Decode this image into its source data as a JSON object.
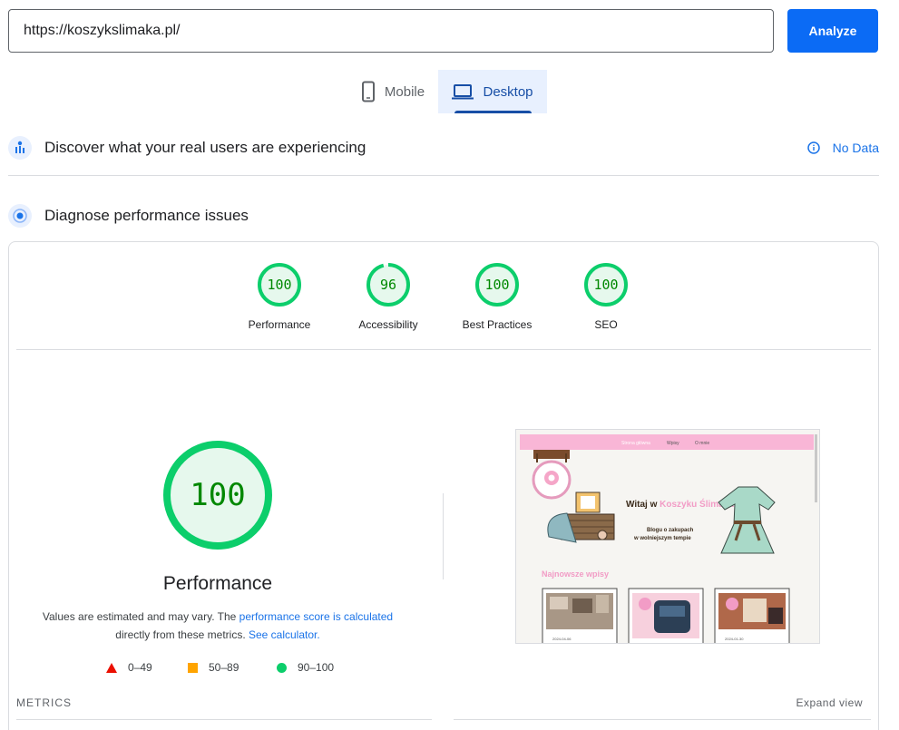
{
  "search": {
    "url_value": "https://koszykslimaka.pl/",
    "analyze_label": "Analyze"
  },
  "tabs": [
    {
      "label": "Mobile",
      "icon": "phone-icon",
      "selected": false
    },
    {
      "label": "Desktop",
      "icon": "laptop-icon",
      "selected": true
    }
  ],
  "field_data": {
    "title": "Discover what your real users are experiencing",
    "status": "No Data"
  },
  "diagnose": {
    "title": "Diagnose performance issues"
  },
  "scores": [
    {
      "label": "Performance",
      "value": "100",
      "fraction": 1.0
    },
    {
      "label": "Accessibility",
      "value": "96",
      "fraction": 0.96
    },
    {
      "label": "Best Practices",
      "value": "100",
      "fraction": 1.0
    },
    {
      "label": "SEO",
      "value": "100",
      "fraction": 1.0
    }
  ],
  "performance": {
    "score": "100",
    "fraction": 1.0,
    "title": "Performance",
    "desc_part1": "Values are estimated and may vary. The ",
    "desc_link1": "performance score is calculated",
    "desc_part2": " directly from these metrics. ",
    "desc_link2": "See calculator.",
    "legend": [
      {
        "range": "0–49",
        "color": "#eb0f00"
      },
      {
        "range": "50–89",
        "color": "#ffa400"
      },
      {
        "range": "90–100",
        "color": "#0cce6b"
      }
    ]
  },
  "preview": {
    "nav": [
      "Strona główna",
      "Wpisy",
      "O mnie"
    ],
    "heading_part1": "Witaj w ",
    "heading_part2": "Koszyku Ślimaka",
    "tagline_line1": "Blogu o zakupach",
    "tagline_line2": "w wolniejszym tempie",
    "posts_title": "Najnowsze wpisy",
    "post_dates": [
      "2024-04-06",
      "",
      "2024-01-30"
    ],
    "accent_color": "#f9b6d6"
  },
  "metrics": {
    "label": "METRICS",
    "expand_label": "Expand view"
  },
  "colors": {
    "good": "#0cce6b",
    "good_text": "#008800",
    "good_bg": "#e6f8ed",
    "accent": "#0b6bf5"
  }
}
